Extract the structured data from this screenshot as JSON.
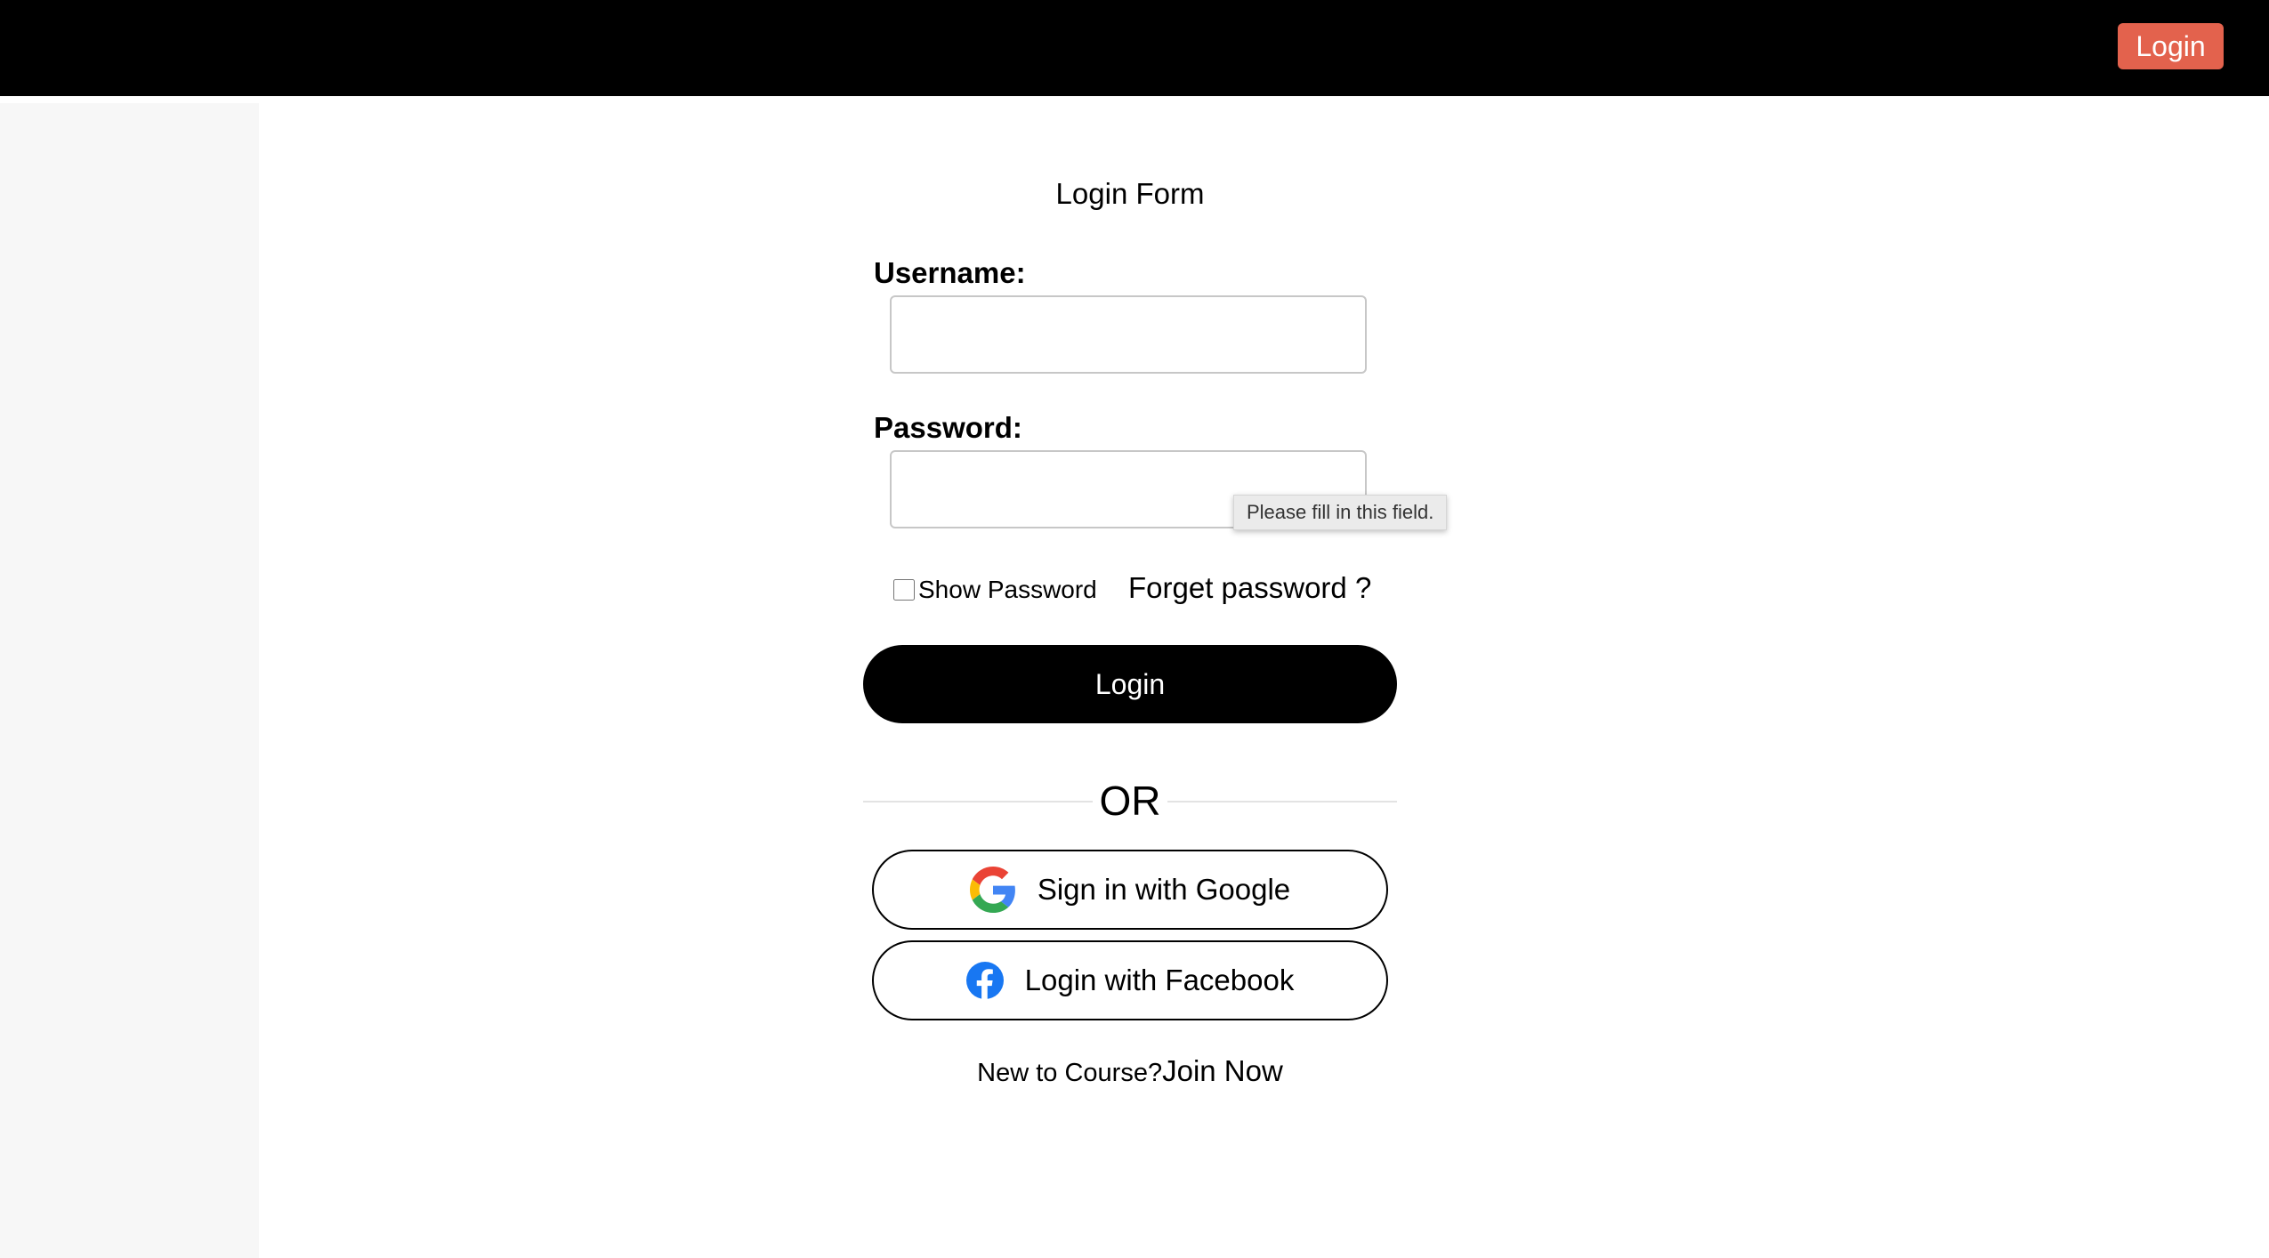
{
  "header": {
    "login_label": "Login",
    "accent_color": "#e3624d"
  },
  "form": {
    "title": "Login Form",
    "username_label": "Username:",
    "username_value": "",
    "password_label": "Password:",
    "password_value": "",
    "validation_tooltip": "Please fill in this field.",
    "show_password_label": "Show Password",
    "show_password_checked": false,
    "forget_password_label": "Forget password ?",
    "login_button_label": "Login",
    "or_label": "OR",
    "google_button_label": "Sign in with Google",
    "google_icon": "google-icon",
    "facebook_button_label": "Login with Facebook",
    "facebook_icon": "facebook-icon",
    "new_user_text": "New to Course?",
    "join_label": "Join Now"
  }
}
